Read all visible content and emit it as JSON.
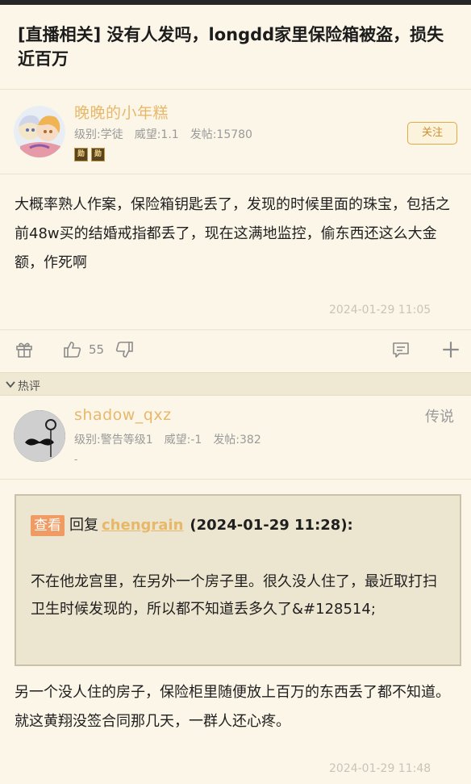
{
  "post": {
    "title": "[直播相关] 没有人发吗，longdd家里保险箱被盗，损失近百万",
    "author": {
      "name": "晚晚的小年糕",
      "level": "级别:学徒",
      "prestige": "威望:1.1",
      "posts": "发帖:15780",
      "badges": [
        "勋",
        "勋"
      ],
      "follow_label": "关注"
    },
    "content": "大概率熟人作案，保险箱钥匙丢了，发现的时候里面的珠宝，包括之前48w买的结婚戒指都丢了，现在这满地监控，偷东西还这么大金额，作死啊",
    "timestamp": "2024-01-29 11:05",
    "like_count": "55"
  },
  "hot_label": "热评",
  "reply": {
    "author": {
      "name": "shadow_qxz",
      "level": "级别:警告等级1",
      "prestige": "威望:-1",
      "posts": "发帖:382",
      "extra": "-"
    },
    "tag": "传说",
    "quote": {
      "check_label": "查看",
      "reply_word": "回复",
      "reply_user": "chengrain",
      "reply_time": "(2024-01-29 11:28):",
      "text": "不在他龙宫里，在另外一个房子里。很久没人住了，最近取打扫卫生时候发现的，所以都不知道丢多久了&#128514;"
    },
    "content": "另一个没人住的房子，保险柜里随便放上百万的东西丢了都不知道。就这黄翔没签合同那几天，一群人还心疼。",
    "timestamp": "2024-01-29 11:48"
  },
  "colors": {
    "background": "#fbf6e8",
    "username": "#e8b86a",
    "accent": "#d08e2c",
    "check_button": "#ef9b63"
  },
  "icons": [
    "gift-icon",
    "thumb-up-icon",
    "thumb-down-icon",
    "comment-icon",
    "plus-icon",
    "chevron-down-icon",
    "mustache-avatar",
    "anime-avatar"
  ]
}
